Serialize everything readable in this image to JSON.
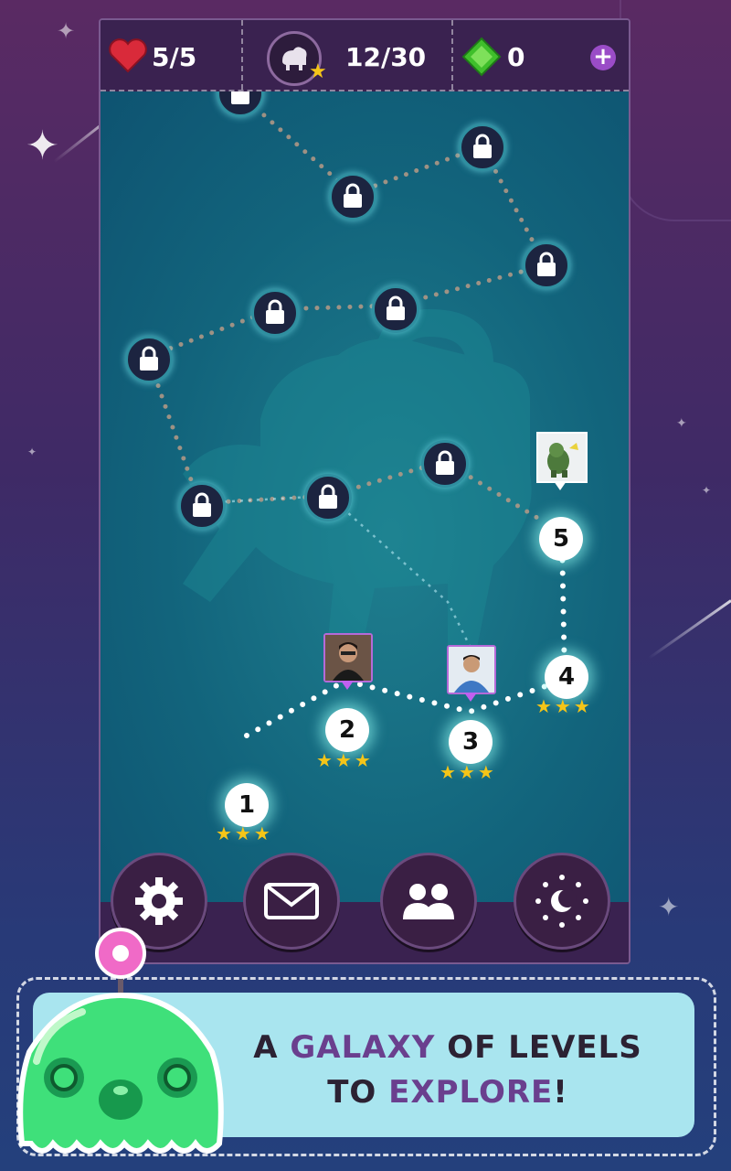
{
  "hud": {
    "lives": "5/5",
    "stars": "12/30",
    "gems": "0",
    "add_label": "+"
  },
  "levels": [
    {
      "number": "1",
      "stars": "★★★"
    },
    {
      "number": "2",
      "stars": "★★★"
    },
    {
      "number": "3",
      "stars": "★★★"
    },
    {
      "number": "4",
      "stars": "★★★"
    },
    {
      "number": "5",
      "stars": ""
    }
  ],
  "bottom_nav": {
    "settings": "settings-icon",
    "mail": "mail-icon",
    "friends": "friends-icon",
    "daynight": "day-night-icon"
  },
  "banner": {
    "line1_a": "A ",
    "line1_b": "GALAXY",
    "line1_c": " OF LEVELS",
    "line2_a": "TO ",
    "line2_b": "EXPLORE",
    "line2_c": "!"
  },
  "colors": {
    "highlight": "#6a3f8e",
    "star": "#f5c518",
    "map": "#12647c"
  }
}
